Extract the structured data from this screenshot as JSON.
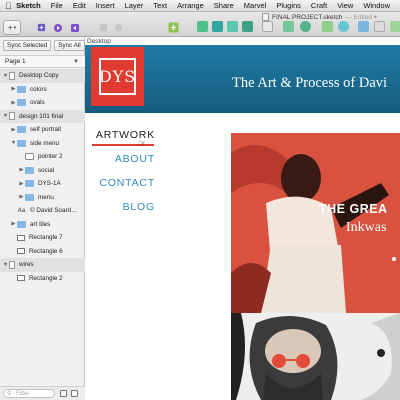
{
  "menubar": {
    "app_name": "Sketch",
    "items": [
      "File",
      "Edit",
      "Insert",
      "Layer",
      "Text",
      "Arrange",
      "Share",
      "Marvel",
      "Plugins",
      "Craft",
      "View",
      "Window"
    ]
  },
  "window": {
    "title": "FINAL PROJECT.sketch",
    "edited": "— Edited ▾"
  },
  "sidebar": {
    "sync_selected": "Sync Selected",
    "sync_all": "Sync All",
    "page_selector": "Page 1",
    "filter_placeholder": "Filter",
    "layers": [
      {
        "label": "Desktop Copy",
        "type": "page",
        "indent": 0,
        "expanded": true,
        "group": true
      },
      {
        "label": "colors",
        "type": "folder",
        "indent": 1,
        "expanded": false
      },
      {
        "label": "ovals",
        "type": "folder",
        "indent": 1,
        "expanded": false
      },
      {
        "label": "design 101 final",
        "type": "page",
        "indent": 0,
        "expanded": true,
        "group": true
      },
      {
        "label": "self portrait",
        "type": "folder",
        "indent": 1,
        "expanded": false
      },
      {
        "label": "side menu",
        "type": "folder",
        "indent": 1,
        "expanded": true
      },
      {
        "label": "pointer 2",
        "type": "symbol",
        "indent": 2
      },
      {
        "label": "social",
        "type": "folder",
        "indent": 2,
        "expanded": false
      },
      {
        "label": "DYS-1A",
        "type": "folder",
        "indent": 2,
        "expanded": false
      },
      {
        "label": "menu",
        "type": "folder",
        "indent": 2,
        "expanded": false
      },
      {
        "label": "© David Soard…",
        "type": "text",
        "indent": 1
      },
      {
        "label": "art tiles",
        "type": "folder",
        "indent": 1,
        "expanded": false
      },
      {
        "label": "Rectangle 7",
        "type": "rect",
        "indent": 1
      },
      {
        "label": "Rectangle 6",
        "type": "rect",
        "indent": 1
      },
      {
        "label": "wires",
        "type": "page",
        "indent": 0,
        "expanded": true,
        "group": true
      },
      {
        "label": "Rectangle 2",
        "type": "rect",
        "indent": 1
      }
    ]
  },
  "canvas": {
    "artboard_name": "Desktop",
    "site_title": "The Art & Process of Davi",
    "logo_text": "DYS",
    "nav": [
      {
        "label": "ARTWORK",
        "active": true
      },
      {
        "label": "ABOUT",
        "active": false
      },
      {
        "label": "CONTACT",
        "active": false
      },
      {
        "label": "BLOG",
        "active": false
      }
    ],
    "hero_title": "THE GREA",
    "hero_subtitle": "Inkwas"
  },
  "colors": {
    "header_blue": "#1a6f95",
    "logo_red": "#e13a32",
    "nav_blue": "#2e8cb8",
    "hero_red": "#d8523f",
    "folder_blue": "#85b8e6"
  }
}
